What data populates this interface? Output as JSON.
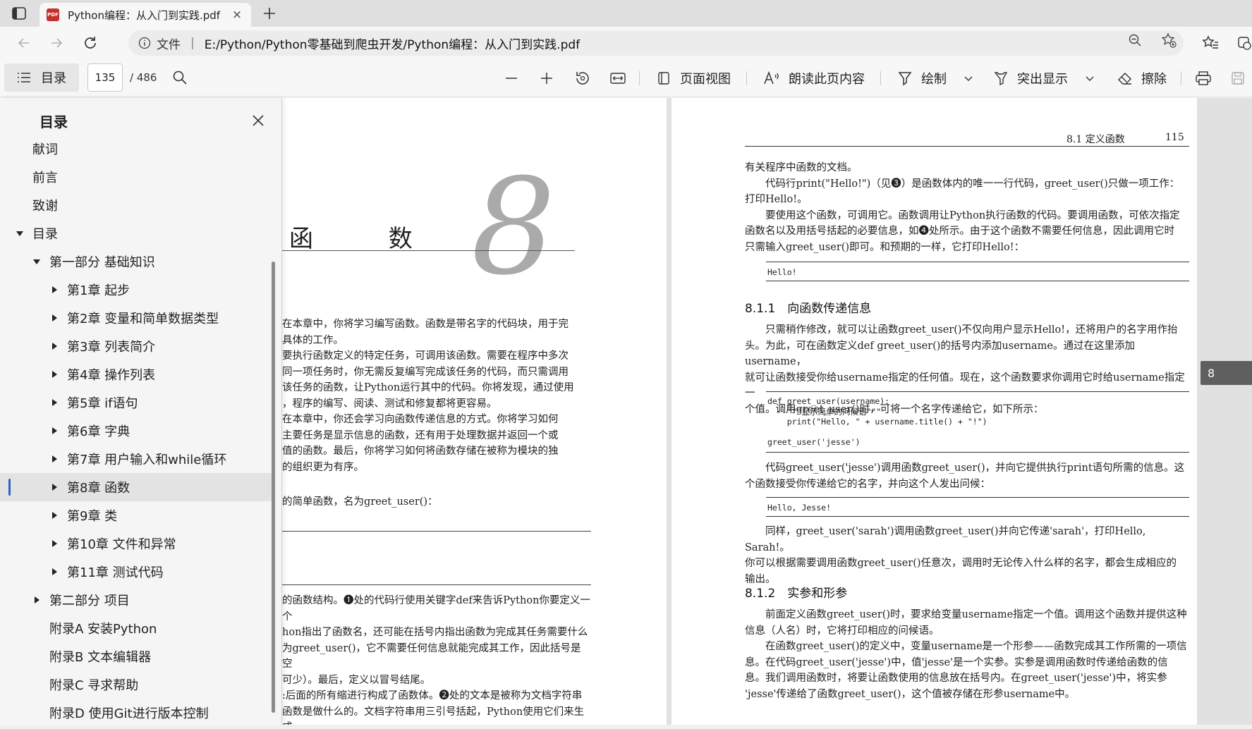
{
  "tab": {
    "title": "Python编程：从入门到实践.pdf",
    "close": "×"
  },
  "address": {
    "label": "文件",
    "separator": "|",
    "url": "E:/Python/Python零基础到爬虫开发/Python编程：从入门到实践.pdf"
  },
  "toolbar": {
    "toc_label": "目录",
    "page_current": "135",
    "page_total": "/ 486",
    "page_view": "页面视图",
    "read_aloud": "朗读此页内容",
    "draw": "绘制",
    "highlight": "突出显示",
    "erase": "擦除"
  },
  "sidebar": {
    "title": "目录",
    "items": [
      {
        "label": "献词",
        "level": 0,
        "arrow": "none"
      },
      {
        "label": "前言",
        "level": 0,
        "arrow": "none"
      },
      {
        "label": "致谢",
        "level": 0,
        "arrow": "none"
      },
      {
        "label": "目录",
        "level": 0,
        "arrow": "down"
      },
      {
        "label": "第一部分 基础知识",
        "level": 1,
        "arrow": "down"
      },
      {
        "label": "第1章 起步",
        "level": 2,
        "arrow": "right"
      },
      {
        "label": "第2章 变量和简单数据类型",
        "level": 2,
        "arrow": "right"
      },
      {
        "label": "第3章 列表简介",
        "level": 2,
        "arrow": "right"
      },
      {
        "label": "第4章 操作列表",
        "level": 2,
        "arrow": "right"
      },
      {
        "label": "第5章 if语句",
        "level": 2,
        "arrow": "right"
      },
      {
        "label": "第6章 字典",
        "level": 2,
        "arrow": "right"
      },
      {
        "label": "第7章 用户输入和while循环",
        "level": 2,
        "arrow": "right"
      },
      {
        "label": "第8章 函数",
        "level": 2,
        "arrow": "right",
        "selected": true
      },
      {
        "label": "第9章 类",
        "level": 2,
        "arrow": "right"
      },
      {
        "label": "第10章 文件和异常",
        "level": 2,
        "arrow": "right"
      },
      {
        "label": "第11章 测试代码",
        "level": 2,
        "arrow": "right"
      },
      {
        "label": "第二部分 项目",
        "level": 1,
        "arrow": "right"
      },
      {
        "label": "附录A 安装Python",
        "level": 1,
        "arrow": "none"
      },
      {
        "label": "附录B 文本编辑器",
        "level": 1,
        "arrow": "none"
      },
      {
        "label": "附录C 寻求帮助",
        "level": 1,
        "arrow": "none"
      },
      {
        "label": "附录D 使用Git进行版本控制",
        "level": 1,
        "arrow": "none"
      }
    ]
  },
  "left_page": {
    "chapter_title": "函 数",
    "chapter_number": "8",
    "intro_lines": [
      "在本章中，你将学习编写函数。函数是带名字的代码块，用于完",
      "具体的工作。",
      "要执行函数定义的特定任务，可调用该函数。需要在程序中多次",
      "同一项任务时，你无需反复编写完成该任务的代码，而只需调用",
      "该任务的函数，让Python运行其中的代码。你将发现，通过使用",
      "，程序的编写、阅读、测试和修复都将更容易。",
      "在本章中，你还会学习向函数传递信息的方式。你将学习如何",
      "主要任务是显示信息的函数，还有用于处理数据并返回一个或",
      "值的函数。最后，你将学习如何将函数存储在被称为模块的独",
      "的组织更为有序。"
    ],
    "simple_line": "的简单函数，名为greet_user()：",
    "lower_lines": [
      "的函数结构。❶处的代码行使用关键字def来告诉Python你要定义一个",
      "hon指出了函数名，还可能在括号内指出函数为完成其任务需要什么",
      "为greet_user()，它不需要任何信息就能完成其工作，因此括号是空",
      "可少）。最后，定义以冒号结尾。",
      ":后面的所有缩进行构成了函数体。❷处的文本是被称为文档字符串",
      "函数是做什么的。文档字符串用三引号括起，Python使用它们来生成"
    ]
  },
  "right_page": {
    "header_section": "8.1 定义函数",
    "header_page": "115",
    "p1": [
      "有关程序中函数的文档。",
      "　　代码行print(\"Hello!\")（见❸）是函数体内的唯一一行代码，greet_user()只做一项工作：",
      "打印Hello!。",
      "　　要使用这个函数，可调用它。函数调用让Python执行函数的代码。要调用函数，可依次指定",
      "函数名以及用括号括起的必要信息，如❹处所示。由于这个函数不需要任何信息，因此调用它时",
      "只需输入greet_user()即可。和预期的一样，它打印Hello!："
    ],
    "code1": "Hello!",
    "sec1": "8.1.1　向函数传递信息",
    "p2": [
      "　　只需稍作修改，就可以让函数greet_user()不仅向用户显示Hello!，还将用户的名字用作抬",
      "头。为此，可在函数定义def greet_user()的括号内添加username。通过在这里添加username，",
      "就可让函数接受你给username指定的任何值。现在，这个函数要求你调用它时给username指定一",
      "个值。调用greet_user()时，可将一个名字传递给它，如下所示："
    ],
    "code2": "def greet_user(username):\n    \"\"\"显示简单的问候语\"\"\"\n    print(\"Hello, \" + username.title() + \"!\")\n\ngreet_user('jesse')",
    "p3": [
      "　　代码greet_user('jesse')调用函数greet_user()，并向它提供执行print语句所需的信息。这",
      "个函数接受你传递给它的名字，并向这个人发出问候："
    ],
    "code3": "Hello, Jesse!",
    "p4": [
      "　　同样，greet_user('sarah')调用函数greet_user()并向它传递'sarah'，打印Hello, Sarah!。",
      "你可以根据需要调用函数greet_user()任意次，调用时无论传入什么样的名字，都会生成相应的",
      "输出。"
    ],
    "sec2": "8.1.2　实参和形参",
    "p5": [
      "　　前面定义函数greet_user()时，要求给变量username指定一个值。调用这个函数并提供这种",
      "信息（人名）时，它将打印相应的问候语。",
      "　　在函数greet_user()的定义中，变量username是一个形参——函数完成其工作所需的一项信",
      "息。在代码greet_user('jesse')中，值'jesse'是一个实参。实参是调用函数时传递给函数的信",
      "息。我们调用函数时，将要让函数使用的信息放在括号内。在greet_user('jesse')中，将实参",
      "'jesse'传递给了函数greet_user()，这个值被存储在形参username中。"
    ]
  },
  "page_badge": "8"
}
